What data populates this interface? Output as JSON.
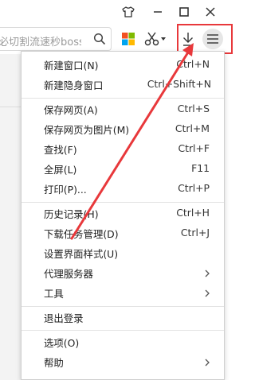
{
  "toolbar": {
    "search_text": "必切割流速秒boss",
    "colors": {
      "highlight": "#e8383b",
      "microsoft": [
        "#f25022",
        "#7fba00",
        "#00a4ef",
        "#ffb900"
      ]
    },
    "icons": [
      "tshirt-icon",
      "minimize-icon",
      "maximize-icon",
      "close-icon",
      "search-icon",
      "microsoft-apps-icon",
      "scissors-icon",
      "dropdown-caret-icon",
      "download-icon",
      "hamburger-menu-icon"
    ]
  },
  "menu": {
    "items": [
      {
        "label": "新建窗口(N)",
        "shortcut": "Ctrl+N"
      },
      {
        "label": "新建隐身窗口",
        "shortcut": "Ctrl+Shift+N"
      },
      {
        "label": "保存网页(A)",
        "shortcut": "Ctrl+S"
      },
      {
        "label": "保存网页为图片(M)",
        "shortcut": "Ctrl+M"
      },
      {
        "label": "查找(F)",
        "shortcut": "Ctrl+F"
      },
      {
        "label": "全屏(L)",
        "shortcut": "F11"
      },
      {
        "label": "打印(P)...",
        "shortcut": "Ctrl+P"
      },
      {
        "label": "历史记录(H)",
        "shortcut": "Ctrl+H"
      },
      {
        "label": "下载任务管理(D)",
        "shortcut": "Ctrl+J"
      },
      {
        "label": "设置界面样式(U)",
        "shortcut": ""
      },
      {
        "label": "代理服务器",
        "shortcut": ""
      },
      {
        "label": "工具",
        "shortcut": ""
      },
      {
        "label": "退出登录",
        "shortcut": ""
      },
      {
        "label": "选项(O)",
        "shortcut": ""
      },
      {
        "label": "帮助",
        "shortcut": ""
      }
    ]
  }
}
